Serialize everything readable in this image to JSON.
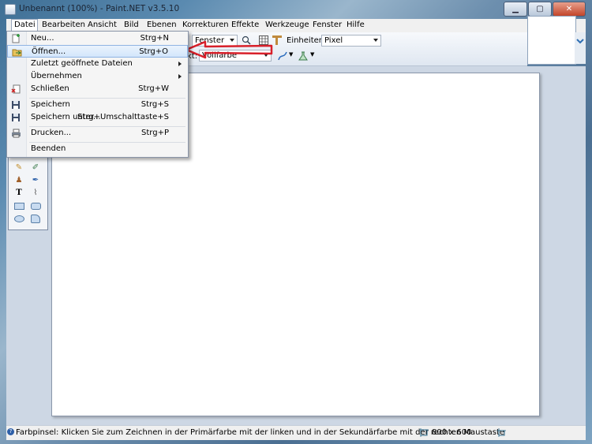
{
  "window": {
    "title": "Unbenannt (100%) - Paint.NET v3.5.10"
  },
  "menubar": {
    "items": [
      "Datei",
      "Bearbeiten",
      "Ansicht",
      "Bild",
      "Ebenen",
      "Korrekturen",
      "Effekte",
      "Werkzeuge",
      "Fenster",
      "Hilfe"
    ]
  },
  "toolbar": {
    "zoom_combo": "Fenster",
    "units_label": "Einheiten:",
    "units_value": "Pixel",
    "effect_label_fragment": "kt:",
    "effect_value_fragment": "Vollfarbe"
  },
  "file_menu": {
    "items": [
      {
        "label": "Neu...",
        "shortcut": "Strg+N",
        "icon": "new-document-icon"
      },
      {
        "label": "Öffnen...",
        "shortcut": "Strg+O",
        "icon": "open-folder-icon",
        "highlighted": true
      },
      {
        "label": "Zuletzt geöffnete Dateien",
        "shortcut": "",
        "submenu": true
      },
      {
        "label": "Übernehmen",
        "shortcut": "",
        "submenu": true
      },
      {
        "label": "Schließen",
        "shortcut": "Strg+W",
        "icon": "close-document-icon"
      },
      {
        "label": "Speichern",
        "shortcut": "Strg+S",
        "icon": "save-icon"
      },
      {
        "label": "Speichern unter...",
        "shortcut": "Strg+Umschalttaste+S",
        "icon": "save-as-icon"
      },
      {
        "label": "Drucken...",
        "shortcut": "Strg+P",
        "icon": "print-icon"
      },
      {
        "label": "Beenden",
        "shortcut": ""
      }
    ]
  },
  "statusbar": {
    "hint": "Farbpinsel: Klicken Sie zum Zeichnen in der Primärfarbe mit der linken und in der Sekundärfarbe mit der rechten Maustaste",
    "image_size": "800 x 600"
  },
  "colors": {
    "annotation_arrow": "#d8202a",
    "highlight": "#d3e6fb"
  }
}
